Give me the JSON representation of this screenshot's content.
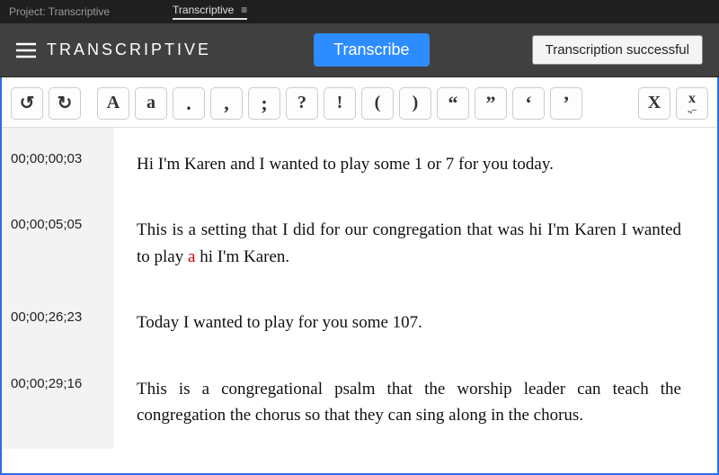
{
  "titlebar": {
    "project_label": "Project: Transcriptive",
    "tab_label": "Transcriptive"
  },
  "header": {
    "brand": "TRANSCRIPTIVE",
    "transcribe_button": "Transcribe",
    "status_button": "Transcription successful"
  },
  "toolbar": {
    "undo": "↺",
    "redo": "↻",
    "upper_a": "A",
    "lower_a": "a",
    "period": ".",
    "comma": ",",
    "semicolon": ";",
    "question": "?",
    "exclaim": "!",
    "paren_open": "(",
    "paren_close": ")",
    "ldquo": "“",
    "rdquo": "”",
    "lsquo": "‘",
    "rsquo": "’",
    "x_upper": "X",
    "x_punct_top": "x",
    "x_punct_bottom": ".,–"
  },
  "lines": [
    {
      "timecode": "00;00;00;03",
      "text_parts": [
        {
          "t": "Hi I'm Karen and I wanted to play some 1 or 7 for you today.",
          "low": false
        }
      ]
    },
    {
      "timecode": "00;00;05;05",
      "text_parts": [
        {
          "t": "This is a setting that I did for our congregation that was hi I'm Karen I wanted to play ",
          "low": false
        },
        {
          "t": "a",
          "low": true
        },
        {
          "t": " hi I'm Karen.",
          "low": false
        }
      ]
    },
    {
      "timecode": "00;00;26;23",
      "text_parts": [
        {
          "t": "Today I wanted to play for you some 107.",
          "low": false
        }
      ]
    },
    {
      "timecode": "00;00;29;16",
      "text_parts": [
        {
          "t": "This is a congregational psalm that the worship leader can teach the congregation the chorus so that they can sing along in the chorus.",
          "low": false
        }
      ]
    }
  ]
}
